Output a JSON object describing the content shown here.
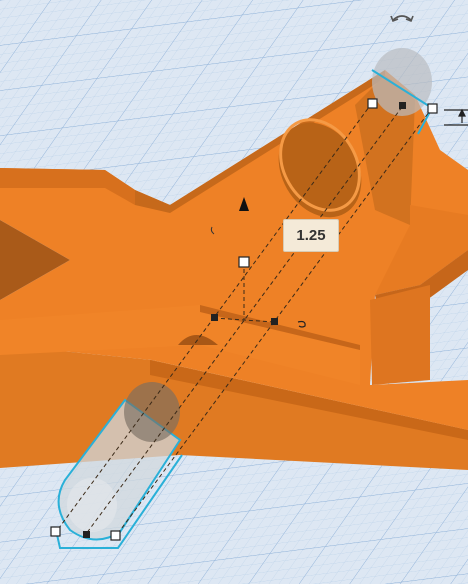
{
  "workplane": {
    "grid_color": "#9fbfe0",
    "background": "#dde7f3"
  },
  "model": {
    "color": "#e97c23",
    "dark_color": "#b45a14",
    "shade_color": "#d06b1c"
  },
  "selection": {
    "shape": "cylinder-hole",
    "outline_color": "#2ab0d8",
    "dimension_value": "1.25"
  },
  "icons": {
    "rotate": "rotate-arrow-icon",
    "height_cone": "height-cone-handle-icon",
    "elevation": "elevation-arrow-icon"
  }
}
